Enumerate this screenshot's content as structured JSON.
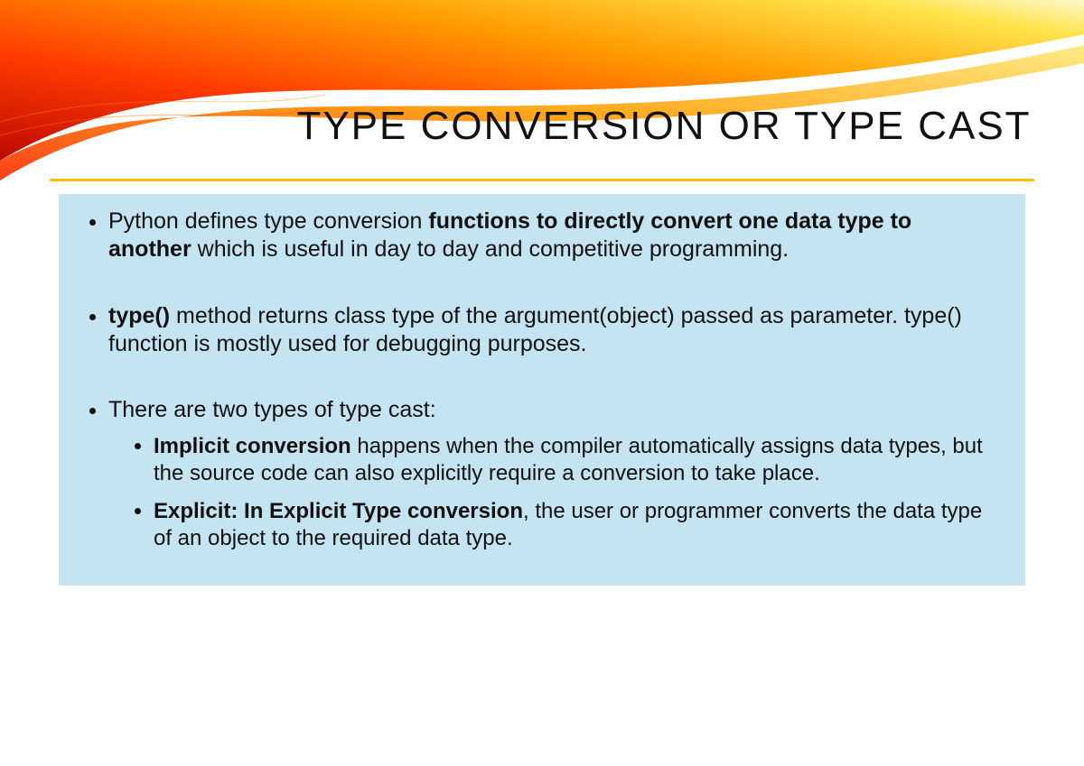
{
  "title": "TYPE CONVERSION OR TYPE CAST",
  "bullet1_pre": "Python defines type conversion ",
  "bullet1_bold": "functions to directly convert one data type to another",
  "bullet1_post": " which is useful in day to day and competitive programming.",
  "bullet2_bold": "type()",
  "bullet2_post": " method returns class type of the argument(object) passed as parameter. type() function is mostly used for debugging purposes.",
  "bullet3_intro": "There are two types of type cast:",
  "sub1_bold": "Implicit conversion",
  "sub1_post": " happens when the compiler automatically assigns data types, but the source code can also explicitly require a conversion to take place.",
  "sub2_bold": "Explicit: In Explicit Type conversion",
  "sub2_post": ", the user or programmer converts the data type of an object to the required data type."
}
